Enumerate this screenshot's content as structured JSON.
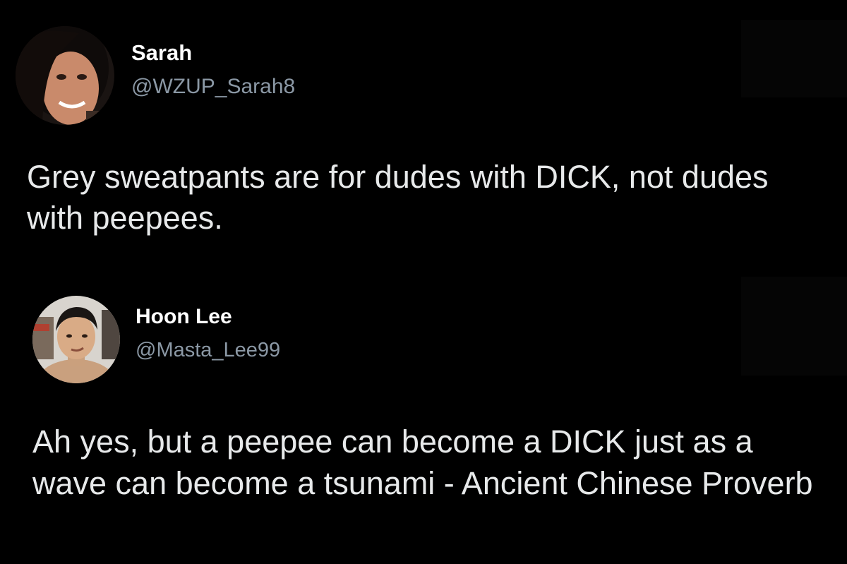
{
  "tweets": [
    {
      "display_name": "Sarah",
      "handle": "@WZUP_Sarah8",
      "avatar_icon": "profile-photo-woman",
      "text": "Grey sweatpants are for dudes with DICK, not dudes with peepees."
    },
    {
      "display_name": "Hoon Lee",
      "handle": "@Masta_Lee99",
      "avatar_icon": "profile-photo-man",
      "text": "Ah yes, but a peepee can become a DICK just as a wave can become a tsunami - Ancient Chinese Proverb"
    }
  ],
  "colors": {
    "background": "#000000",
    "display_name": "#ffffff",
    "handle": "#8b98a5",
    "body_text": "#e7e9ea"
  }
}
